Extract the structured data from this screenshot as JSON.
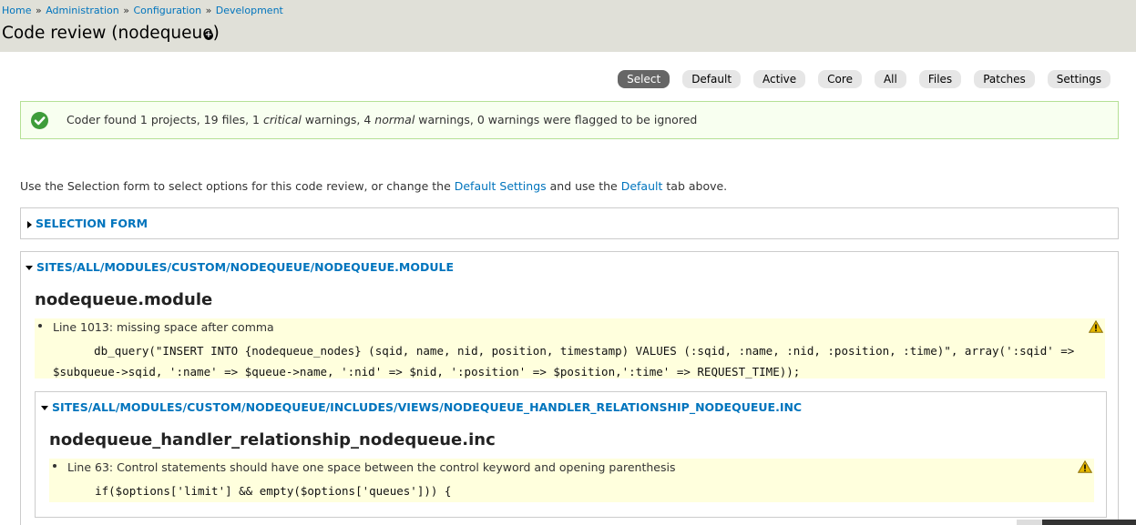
{
  "breadcrumb": {
    "items": [
      "Home",
      "Administration",
      "Configuration",
      "Development"
    ],
    "separator": "»"
  },
  "page": {
    "title": "Code review (nodequeue)",
    "shortcut_icon": "plus-circle-icon"
  },
  "tabs": [
    {
      "label": "Select",
      "active": true
    },
    {
      "label": "Default",
      "active": false
    },
    {
      "label": "Active",
      "active": false
    },
    {
      "label": "Core",
      "active": false
    },
    {
      "label": "All",
      "active": false
    },
    {
      "label": "Files",
      "active": false
    },
    {
      "label": "Patches",
      "active": false
    },
    {
      "label": "Settings",
      "active": false
    }
  ],
  "status": {
    "icon": "check-circle-icon",
    "prefix": "Coder found 1 projects, 19 files, 1 ",
    "critical": "critical",
    "middle": " warnings, 4 ",
    "normal": "normal",
    "suffix": " warnings, 0 warnings were flagged to be ignored"
  },
  "intro": {
    "text1": "Use the Selection form to select options for this code review, or change the ",
    "link1": "Default Settings",
    "text2": " and use the ",
    "link2": "Default",
    "text3": " tab above."
  },
  "selection_form": {
    "legend": "Selection form",
    "collapsed": true
  },
  "module_fieldset": {
    "legend": "sites/all/modules/custom/nodequeue/nodequeue.module",
    "heading": "nodequeue.module",
    "warning": {
      "message": "Line 1013: missing space after comma",
      "code": "      db_query(\"INSERT INTO {nodequeue_nodes} (sqid, name, nid, position, timestamp) VALUES (:sqid, :name, :nid, :position, :time)\", array(':sqid' => $subqueue->sqid, ':name' => $queue->name, ':nid' => $nid, ':position' => $position,':time' => REQUEST_TIME));"
    }
  },
  "inc_fieldset": {
    "legend": "sites/all/modules/custom/nodequeue/includes/views/nodequeue_handler_relationship_nodequeue.inc",
    "heading": "nodequeue_handler_relationship_nodequeue.inc",
    "warning": {
      "message": "Line 63: Control statements should have one space between the control keyword and opening parenthesis",
      "code": "    if($options['limit'] && empty($options['queues'])) {"
    }
  },
  "colors": {
    "link": "#0074bd",
    "header_bg": "#e0e0d8",
    "status_bg": "#f8fff0",
    "status_border": "#b5e095",
    "warning_bg": "#ffffdd",
    "tab_active": "#666666"
  }
}
